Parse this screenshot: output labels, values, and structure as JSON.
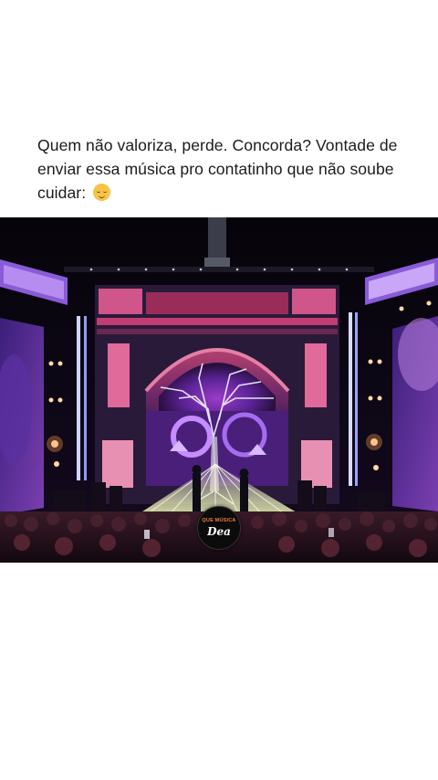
{
  "post": {
    "caption": "Quem não valoriza, perde. Concorda? Vontade de enviar essa música pro contatinho que não soube cuidar:",
    "caption_emoji": "relieved-face-emoji"
  },
  "video": {
    "watermark_top": "QUE MÚSICA",
    "watermark_bottom": "Dea"
  },
  "colors": {
    "background": "#ffffff",
    "caption_text": "#1c1c1c",
    "video_background": "#07050c",
    "stage_pink": "#e0639a",
    "stage_purple": "#6a2fa8",
    "watermark_accent": "#f07c3a"
  }
}
